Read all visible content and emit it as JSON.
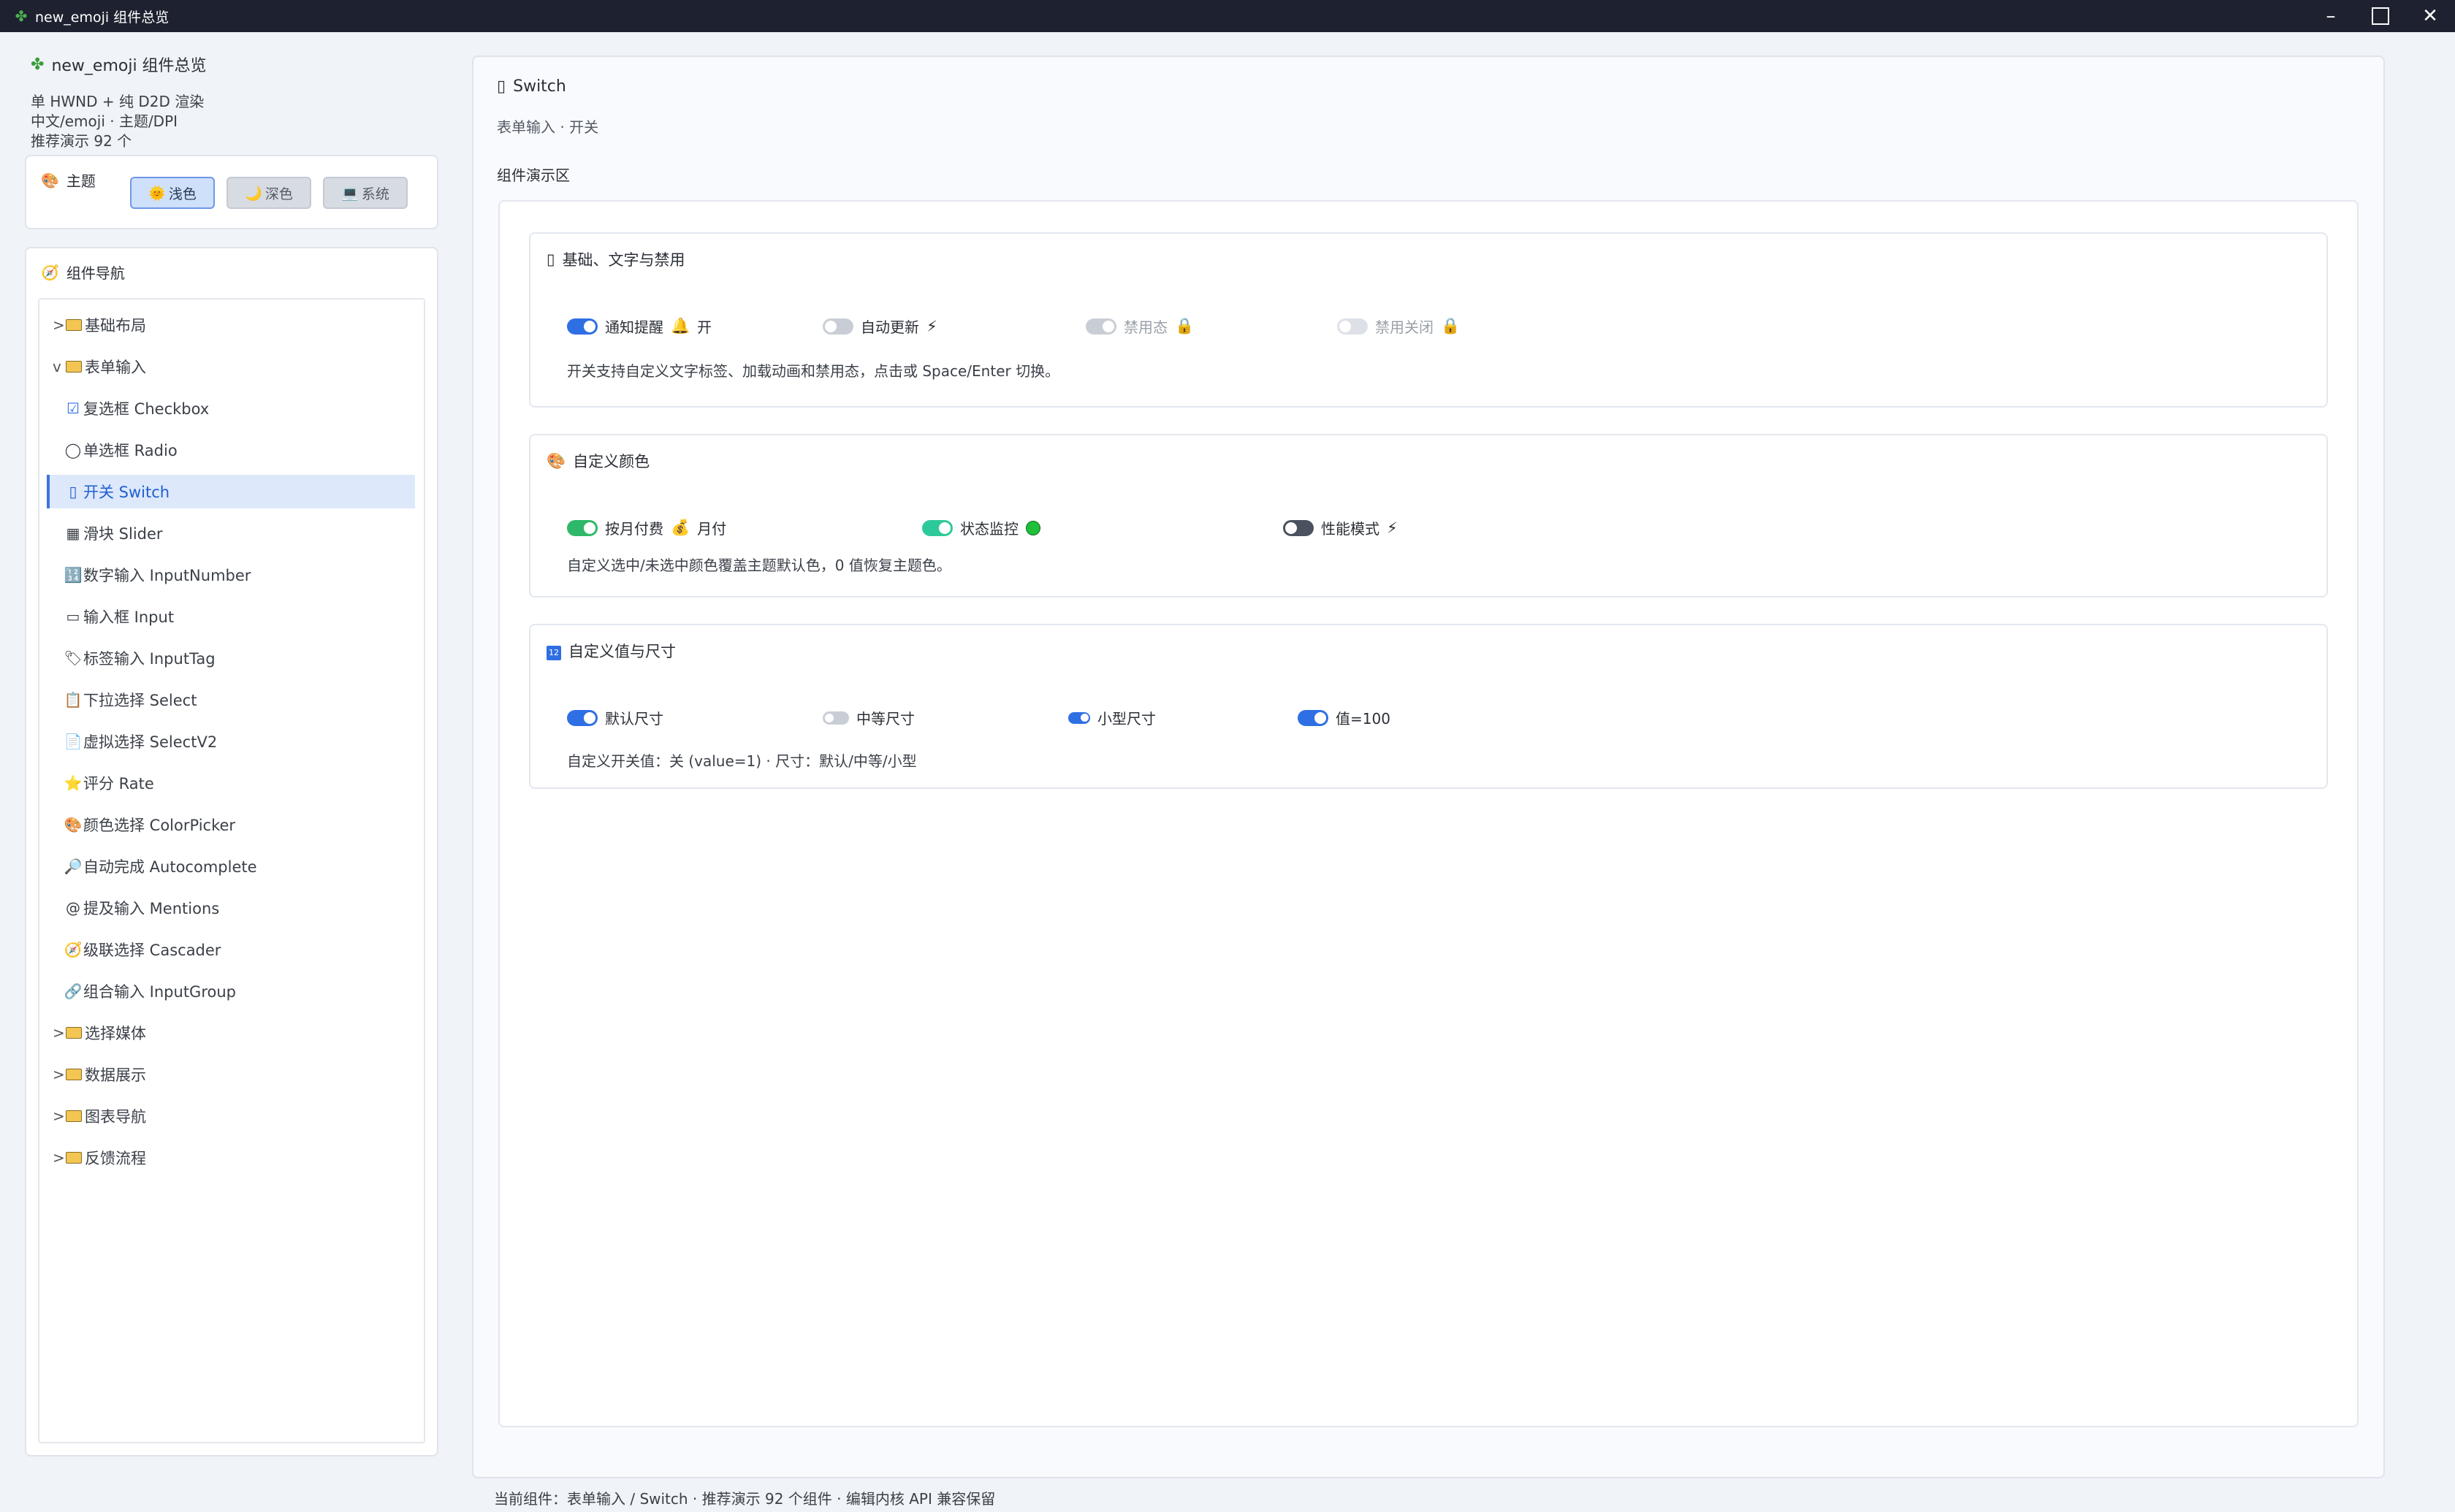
{
  "window": {
    "title": "new_emoji 组件总览"
  },
  "sidebar": {
    "title": "new_emoji 组件总览",
    "info": [
      "单 HWND + 纯 D2D 渲染",
      "中文/emoji · 主题/DPI",
      "推荐演示 92 个"
    ],
    "theme": {
      "label": "主题",
      "buttons": [
        {
          "label": "浅色",
          "icon": "sun-icon",
          "active": true
        },
        {
          "label": "深色",
          "icon": "moon-icon",
          "active": false
        },
        {
          "label": "系统",
          "icon": "laptop-icon",
          "active": false
        }
      ]
    },
    "nav": {
      "title": "组件导航",
      "items": [
        {
          "label": "基础布局",
          "twisty": ">",
          "type": "group"
        },
        {
          "label": "表单输入",
          "twisty": "v",
          "type": "group"
        },
        {
          "label": "复选框 Checkbox",
          "icon": "checkbox-icon",
          "glyph": "☑",
          "type": "child"
        },
        {
          "label": "单选框 Radio",
          "icon": "radio-icon",
          "glyph": "◯",
          "type": "child"
        },
        {
          "label": "开关 Switch",
          "icon": "switch-icon",
          "glyph": "▯",
          "type": "child",
          "selected": true
        },
        {
          "label": "滑块 Slider",
          "icon": "slider-icon",
          "glyph": "▦",
          "type": "child"
        },
        {
          "label": "数字输入 InputNumber",
          "icon": "number-input-icon",
          "glyph": "🔢",
          "type": "child"
        },
        {
          "label": "输入框 Input",
          "icon": "input-icon",
          "glyph": "▭",
          "type": "child"
        },
        {
          "label": "标签输入 InputTag",
          "icon": "tag-icon",
          "glyph": "🏷",
          "type": "child"
        },
        {
          "label": "下拉选择 Select",
          "icon": "clipboard-icon",
          "glyph": "📋",
          "type": "child"
        },
        {
          "label": "虚拟选择 SelectV2",
          "icon": "document-icon",
          "glyph": "📄",
          "type": "child"
        },
        {
          "label": "评分 Rate",
          "icon": "star-icon",
          "glyph": "⭐",
          "type": "child"
        },
        {
          "label": "颜色选择 ColorPicker",
          "icon": "palette-icon",
          "glyph": "🎨",
          "type": "child"
        },
        {
          "label": "自动完成 Autocomplete",
          "icon": "magnifier-icon",
          "glyph": "🔎",
          "type": "child"
        },
        {
          "label": "提及输入 Mentions",
          "icon": "at-icon",
          "glyph": "@",
          "type": "child"
        },
        {
          "label": "级联选择 Cascader",
          "icon": "compass-icon",
          "glyph": "🧭",
          "type": "child"
        },
        {
          "label": "组合输入 InputGroup",
          "icon": "link-icon",
          "glyph": "🔗",
          "type": "child"
        },
        {
          "label": "选择媒体",
          "twisty": ">",
          "type": "group"
        },
        {
          "label": "数据展示",
          "twisty": ">",
          "type": "group"
        },
        {
          "label": "图表导航",
          "twisty": ">",
          "type": "group"
        },
        {
          "label": "反馈流程",
          "twisty": ">",
          "type": "group"
        }
      ]
    }
  },
  "main": {
    "title": "Switch",
    "subtitle": "表单输入 · 开关",
    "area_label": "组件演示区",
    "sections": [
      {
        "title": "基础、文字与禁用",
        "icon": "switch-icon",
        "switches": [
          {
            "label": "通知提醒",
            "suffix": "开",
            "emoji": "🔔",
            "emoji_name": "bell-icon",
            "state": "on",
            "on_color": "#2f6fe4"
          },
          {
            "label": "自动更新",
            "suffix": "",
            "emoji": "⚡",
            "emoji_name": "lightning-icon",
            "state": "off"
          },
          {
            "label": "禁用态",
            "suffix": "",
            "emoji": "🔒",
            "emoji_name": "lock-icon",
            "state": "on-disabled"
          },
          {
            "label": "禁用关闭",
            "suffix": "",
            "emoji": "🔒",
            "emoji_name": "lock-icon",
            "state": "off-disabled"
          }
        ],
        "desc": "开关支持自定义文字标签、加载动画和禁用态，点击或 Space/Enter 切换。"
      },
      {
        "title": "自定义颜色",
        "icon": "palette-icon",
        "switches": [
          {
            "label": "按月付费",
            "suffix": "月付",
            "emoji": "💰",
            "emoji_name": "money-bag-icon",
            "state": "on",
            "on_color": "#2fb86a"
          },
          {
            "label": "状态监控",
            "suffix": "",
            "emoji": "🟢",
            "emoji_name": "green-circle-icon",
            "state": "on",
            "on_color": "#2ec99a"
          },
          {
            "label": "性能模式",
            "suffix": "",
            "emoji": "⚡",
            "emoji_name": "lightning-icon",
            "state": "off",
            "off_color": "#4a5160"
          }
        ],
        "desc": "自定义选中/未选中颜色覆盖主题默认色，0 值恢复主题色。"
      },
      {
        "title": "自定义值与尺寸",
        "icon": "number-input-icon",
        "switches": [
          {
            "label": "默认尺寸",
            "state": "on",
            "on_color": "#2f6fe4",
            "size": "default"
          },
          {
            "label": "中等尺寸",
            "state": "off",
            "size": "medium"
          },
          {
            "label": "小型尺寸",
            "state": "on",
            "on_color": "#2f6fe4",
            "size": "small"
          },
          {
            "label": "值=100",
            "state": "on",
            "on_color": "#2f6fe4",
            "size": "default"
          }
        ],
        "desc": "自定义开关值：关 (value=1) · 尺寸：默认/中等/小型"
      }
    ]
  },
  "status_bar": {
    "text": "当前组件：表单输入 / Switch · 推荐演示 92 个组件 · 编辑内核 API 兼容保留"
  },
  "colors": {
    "accent": "#2f6fe4",
    "selected_bg": "#dde8fb",
    "titlebar": "#1e2230"
  }
}
